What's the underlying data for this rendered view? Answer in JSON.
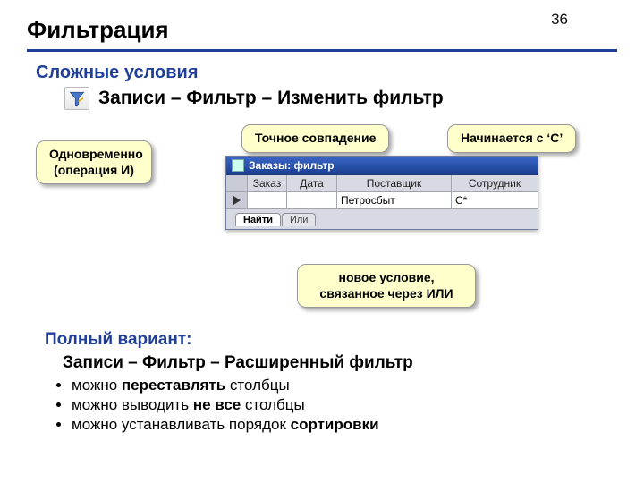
{
  "slide_number": "36",
  "heading": "Фильтрация",
  "subhead": "Сложные условия",
  "path1": "Записи – Фильтр – Изменить фильтр",
  "bubbles": {
    "and": "Одновременно\n(операция И)",
    "exact": "Точное совпадение",
    "starts": "Начается с ‘С’",
    "starts_full": "Начинается с ‘С’",
    "or_cond": "новое условие,\nсвязанное через ИЛИ"
  },
  "window": {
    "title": "Заказы: фильтр",
    "cols": {
      "c1": "Заказ",
      "c2": "Дата",
      "c3": "Поставщик",
      "c4": "Сотрудник"
    },
    "row": {
      "c1": "",
      "c2": "",
      "c3": "Петросбыт",
      "c4": "С*"
    },
    "tabs": {
      "find": "Найти",
      "or": "Или"
    }
  },
  "full": {
    "head": "Полный вариант:",
    "path": "Записи – Фильтр – Расширенный фильтр",
    "b1a": "можно ",
    "b1b": "переставлять",
    "b1c": " столбцы",
    "b2a": "можно выводить ",
    "b2b": "не все",
    "b2c": " столбцы",
    "b3a": "можно устанавливать порядок  ",
    "b3b": "сортировки"
  }
}
